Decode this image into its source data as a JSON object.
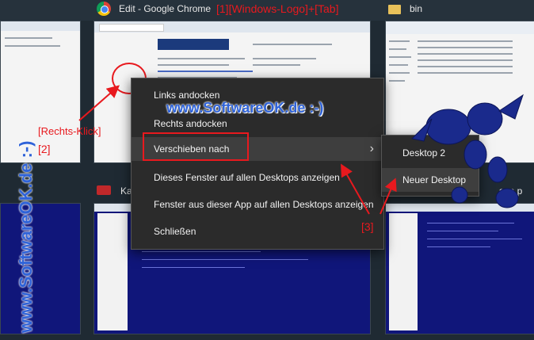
{
  "windows": [
    {
      "title": "Edit - Google Chrome",
      "icon": "chrome-icon"
    },
    {
      "title": "bin",
      "icon": "folder-icon"
    },
    {
      "title": "Ka",
      "icon": "app-icon"
    },
    {
      "title": "sen.p",
      "icon": "app-icon"
    }
  ],
  "context_menu": {
    "items": [
      {
        "label": "Links andocken"
      },
      {
        "label": "Rechts andocken"
      },
      {
        "label": "Verschieben nach",
        "has_submenu": true
      },
      {
        "label": "Dieses Fenster auf allen Desktops anzeigen"
      },
      {
        "label": "Fenster aus dieser App auf allen Desktops anzeigen"
      },
      {
        "label": "Schließen"
      }
    ],
    "submenu": [
      "Desktop 2",
      "Neuer Desktop"
    ]
  },
  "annotations": {
    "step1": "[1][Windows-Logo]+[Tab]",
    "step_right_click": "[Rechts-Klick]",
    "step2": "[2]",
    "step3": "[3]",
    "watermark": "www.SoftwareOK.de :-)",
    "accent": "#e8191e"
  }
}
